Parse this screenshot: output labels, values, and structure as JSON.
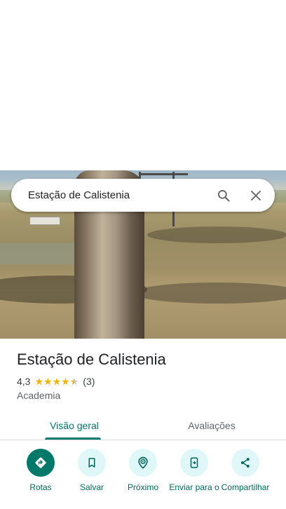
{
  "search": {
    "query": "Estação de Calistenia",
    "search_icon": "search-icon",
    "close_icon": "close-icon"
  },
  "place": {
    "name": "Estação de Calistenia",
    "rating": "4,3",
    "rating_value": 4.3,
    "reviews_count": "(3)",
    "category": "Academia"
  },
  "tabs": [
    {
      "label": "Visão geral",
      "active": true
    },
    {
      "label": "Avaliações",
      "active": false
    }
  ],
  "actions": [
    {
      "label": "Rotas",
      "icon": "directions-icon"
    },
    {
      "label": "Salvar",
      "icon": "bookmark-icon"
    },
    {
      "label": "Próximo",
      "icon": "nearby-icon"
    },
    {
      "label": "Enviar para o",
      "icon": "send-to-phone-icon"
    },
    {
      "label": "Compartilhar",
      "icon": "share-icon"
    }
  ],
  "colors": {
    "accent": "#00796b",
    "action_bg": "#e0f7fa",
    "star": "#f4b400"
  }
}
